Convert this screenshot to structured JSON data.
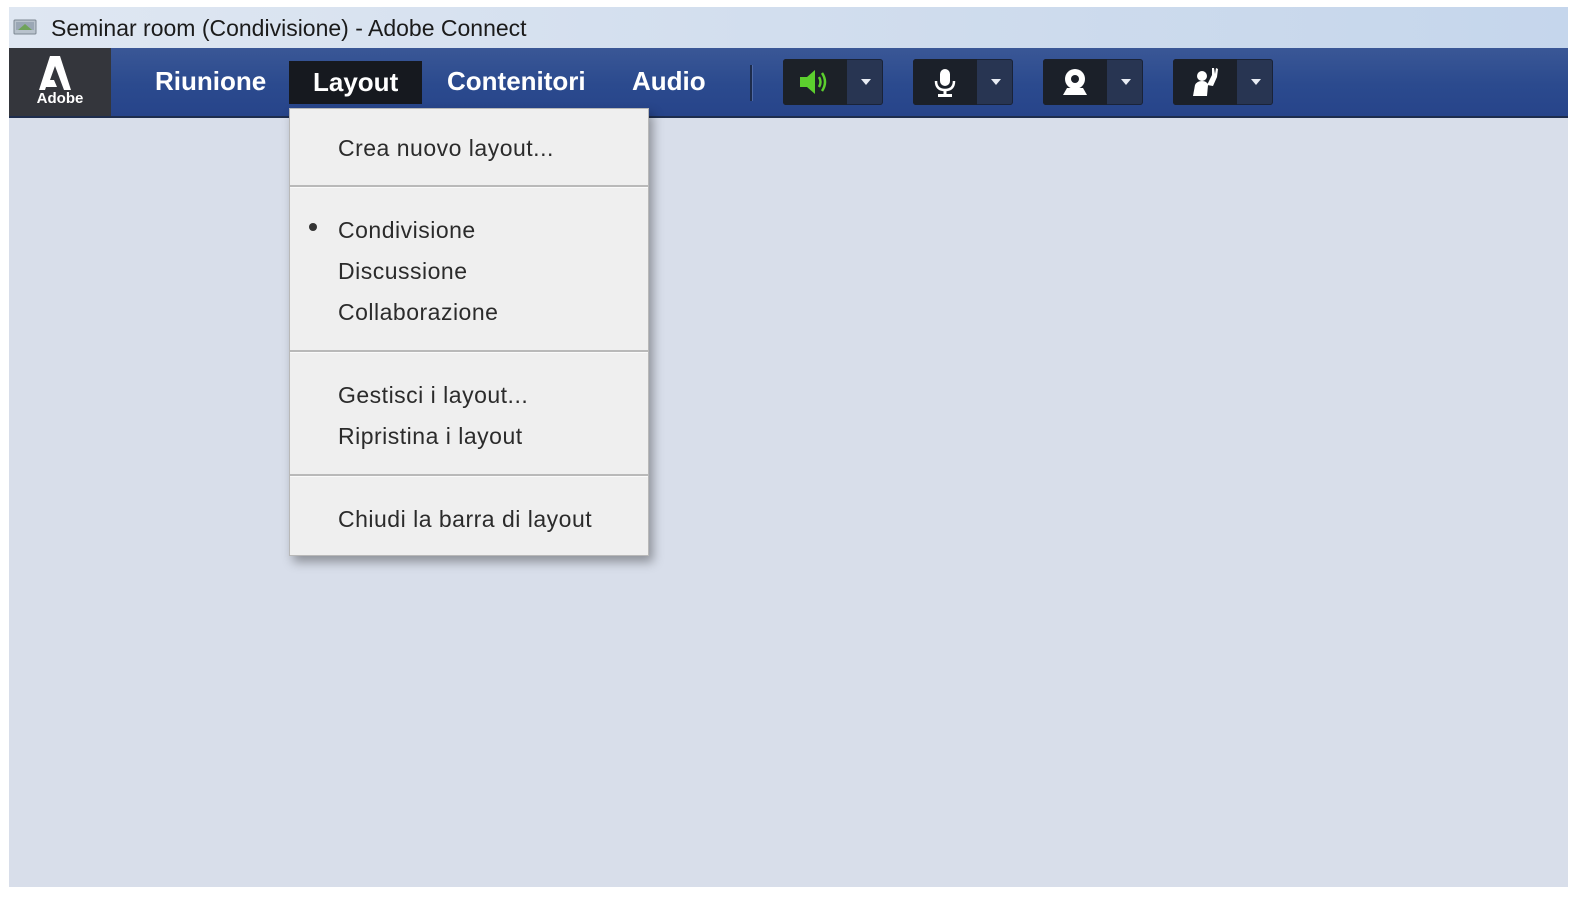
{
  "window": {
    "title": "Seminar room (Condivisione) - Adobe Connect"
  },
  "logo": {
    "text": "Adobe"
  },
  "menubar": {
    "items": [
      {
        "label": "Riunione"
      },
      {
        "label": "Layout",
        "active": true
      },
      {
        "label": "Contenitori"
      },
      {
        "label": "Audio"
      }
    ]
  },
  "toolbar": {
    "buttons": [
      {
        "icon": "speaker-icon",
        "active": true,
        "color": "#5ccf2e"
      },
      {
        "icon": "microphone-icon"
      },
      {
        "icon": "webcam-icon"
      },
      {
        "icon": "raise-hand-icon"
      }
    ]
  },
  "layout_menu": {
    "items": [
      {
        "label": "Crea nuovo layout..."
      },
      {
        "label": "Condivisione",
        "selected": true
      },
      {
        "label": "Discussione"
      },
      {
        "label": "Collaborazione"
      },
      {
        "label": "Gestisci i layout..."
      },
      {
        "label": "Ripristina i layout"
      },
      {
        "label": "Chiudi la barra di layout"
      }
    ]
  },
  "colors": {
    "menubar": "#2b4a8e",
    "workspace": "#d8deea",
    "menu_bg": "#efefef"
  }
}
